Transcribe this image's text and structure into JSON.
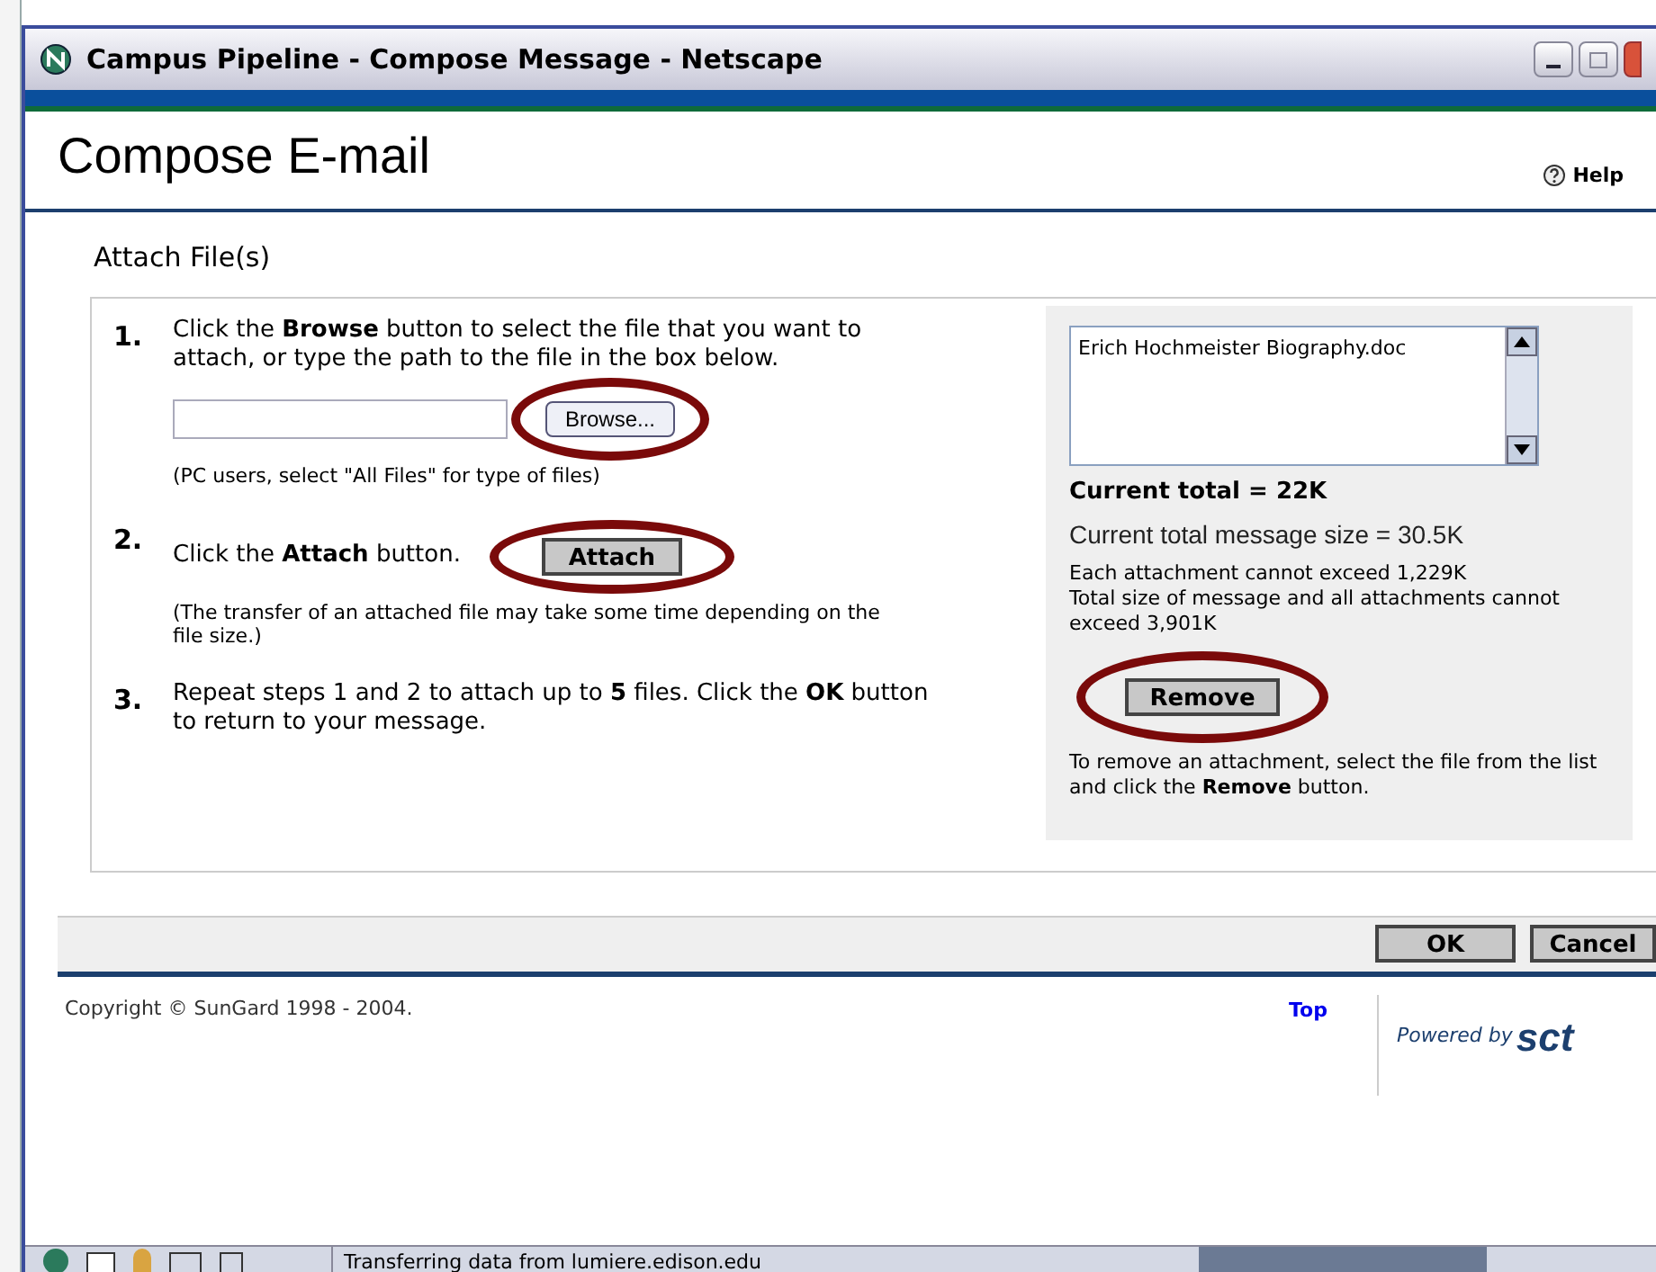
{
  "window": {
    "title": "Campus Pipeline - Compose Message - Netscape"
  },
  "page": {
    "heading": "Compose E-mail",
    "help": "Help"
  },
  "section_title": "Attach File(s)",
  "steps": [
    {
      "kind": "browse",
      "number": "1.",
      "text": "Click the **Browse** button to select the file that you want to attach, or type the path to the file in the box below.",
      "button": "Browse...",
      "note": "(PC users, select \"All Files\" for type of files)"
    },
    {
      "kind": "attach",
      "number": "2.",
      "text": "Click the **Attach** button.",
      "button": "Attach",
      "note": "(The transfer of an attached file may take some time depending on the file size.)"
    },
    {
      "kind": "text",
      "number": "3.",
      "text": "Repeat steps 1 and 2 to attach up to **5** files. Click the **OK** button to return to your message."
    }
  ],
  "attachments": {
    "files": [
      "Erich Hochmeister Biography.doc"
    ],
    "current_total": "Current total = 22K",
    "message_size": "Current total message size = 30.5K",
    "limits": [
      "Each attachment cannot exceed 1,229K",
      "Total size of message and all attachments cannot exceed 3,901K"
    ],
    "remove_button": "Remove",
    "remove_hint": "To remove an attachment, select the file from the list and click the **Remove** button."
  },
  "buttons": [
    "OK",
    "Cancel"
  ],
  "footer": {
    "copyright": "Copyright © SunGard 1998 - 2004.",
    "top_link": "Top",
    "powered_by": "Powered by",
    "logo": "sct"
  },
  "status_bar": {
    "text": "Transferring data from lumiere.edison.edu"
  }
}
